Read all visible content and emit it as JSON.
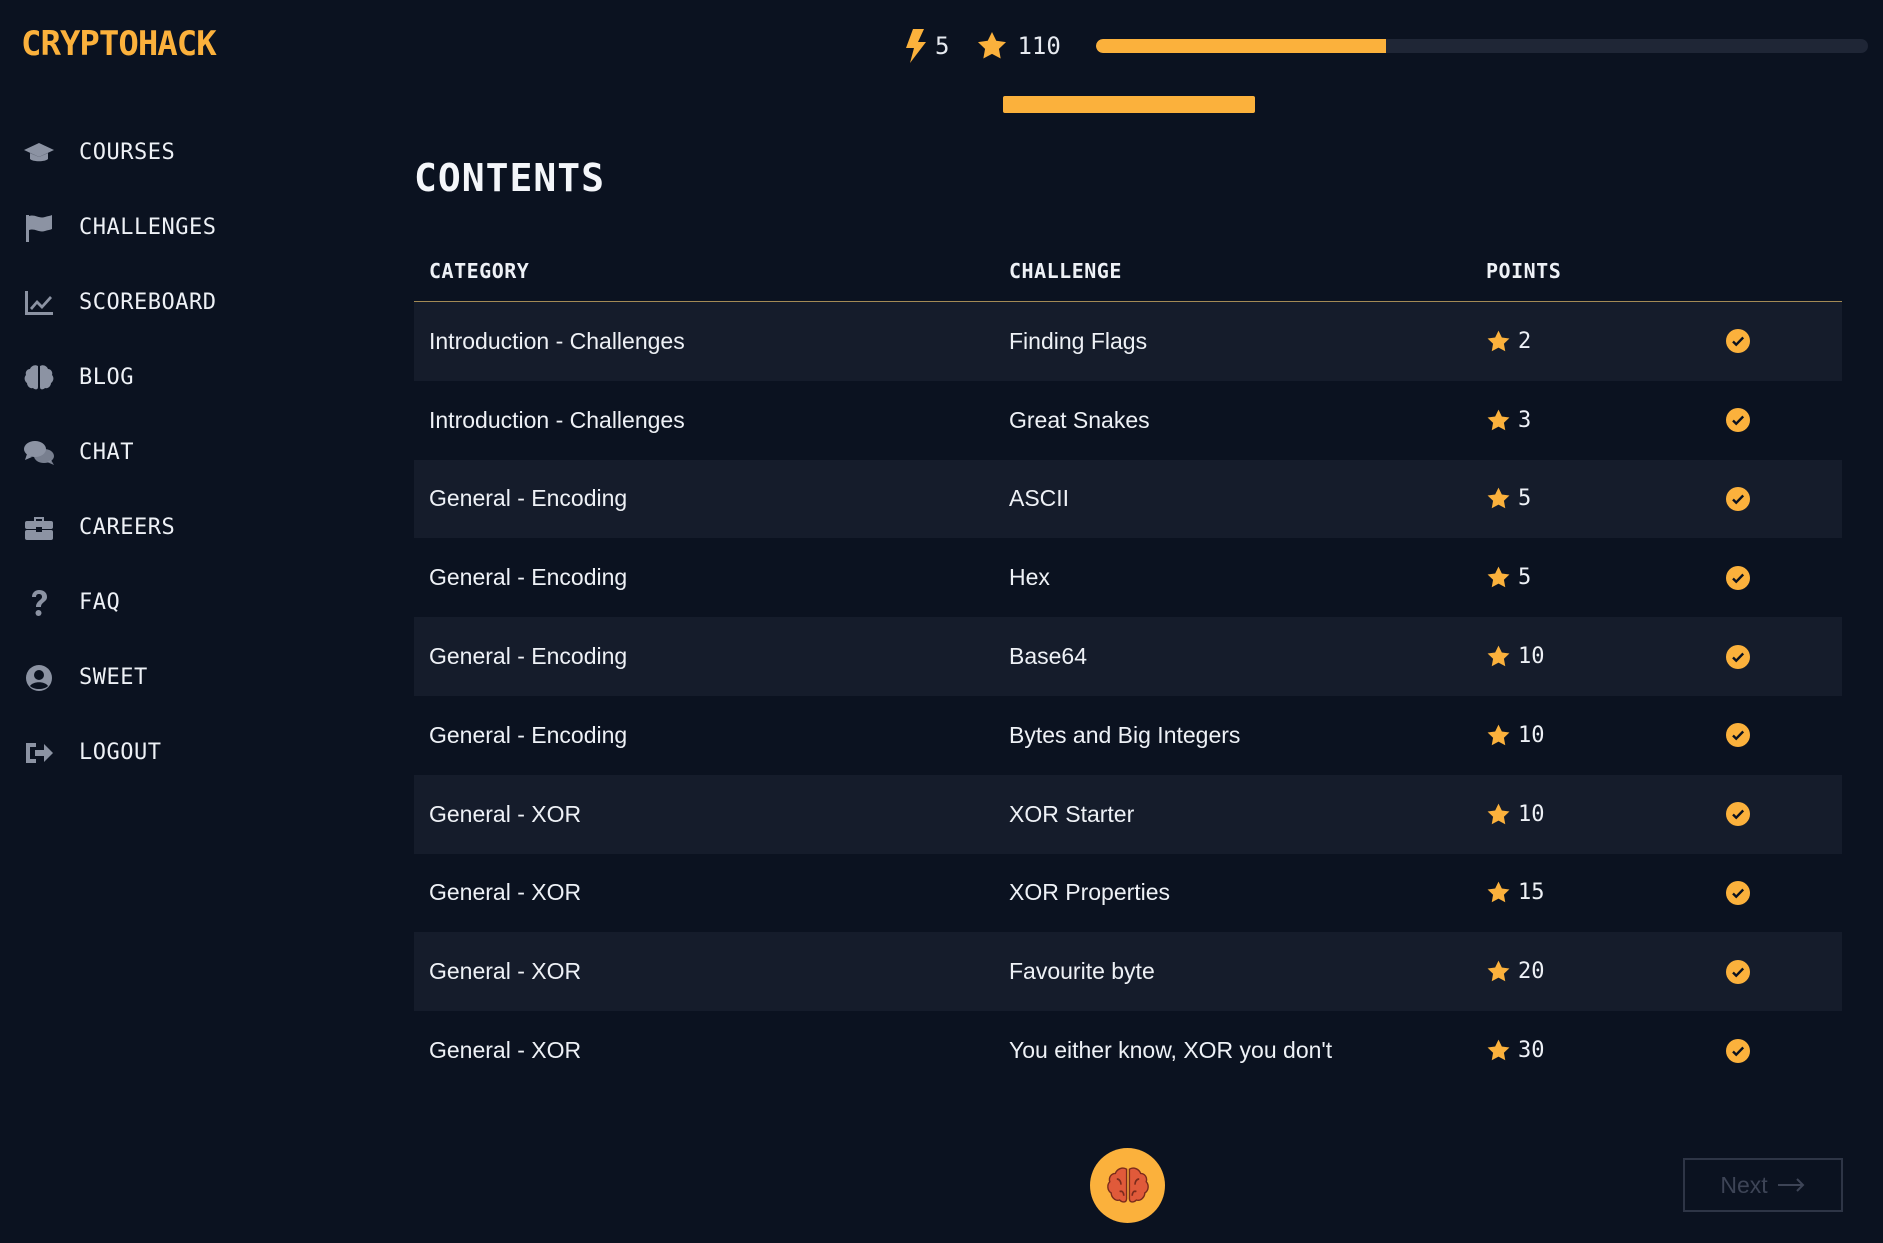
{
  "app": {
    "logo": "CRYPTOHACK"
  },
  "sidebar": {
    "items": [
      {
        "label": "COURSES",
        "icon": "graduation-cap-icon"
      },
      {
        "label": "CHALLENGES",
        "icon": "flag-icon"
      },
      {
        "label": "SCOREBOARD",
        "icon": "chart-line-icon"
      },
      {
        "label": "BLOG",
        "icon": "brain-icon"
      },
      {
        "label": "CHAT",
        "icon": "comments-icon"
      },
      {
        "label": "CAREERS",
        "icon": "briefcase-icon"
      },
      {
        "label": "FAQ",
        "icon": "question-icon"
      },
      {
        "label": "SWEET",
        "icon": "user-circle-icon"
      },
      {
        "label": "LOGOUT",
        "icon": "sign-out-icon"
      }
    ]
  },
  "stats": {
    "streak": "5",
    "points": "110",
    "progress_fraction": 0.375
  },
  "colors": {
    "accent": "#fbb13c",
    "background": "#0b1220",
    "row_alt": "#151c2b"
  },
  "contents": {
    "heading": "CONTENTS",
    "headers": {
      "category": "CATEGORY",
      "challenge": "CHALLENGE",
      "points": "POINTS"
    },
    "rows": [
      {
        "category": "Introduction - Challenges",
        "challenge": "Finding Flags",
        "points": "2"
      },
      {
        "category": "Introduction - Challenges",
        "challenge": "Great Snakes",
        "points": "3"
      },
      {
        "category": "General - Encoding",
        "challenge": "ASCII",
        "points": "5"
      },
      {
        "category": "General - Encoding",
        "challenge": "Hex",
        "points": "5"
      },
      {
        "category": "General - Encoding",
        "challenge": "Base64",
        "points": "10"
      },
      {
        "category": "General - Encoding",
        "challenge": "Bytes and Big Integers",
        "points": "10"
      },
      {
        "category": "General - XOR",
        "challenge": "XOR Starter",
        "points": "10"
      },
      {
        "category": "General - XOR",
        "challenge": "XOR Properties",
        "points": "15"
      },
      {
        "category": "General - XOR",
        "challenge": "Favourite byte",
        "points": "20"
      },
      {
        "category": "General - XOR",
        "challenge": "You either know, XOR you don't",
        "points": "30"
      }
    ]
  },
  "footer": {
    "next_label": "Next"
  }
}
